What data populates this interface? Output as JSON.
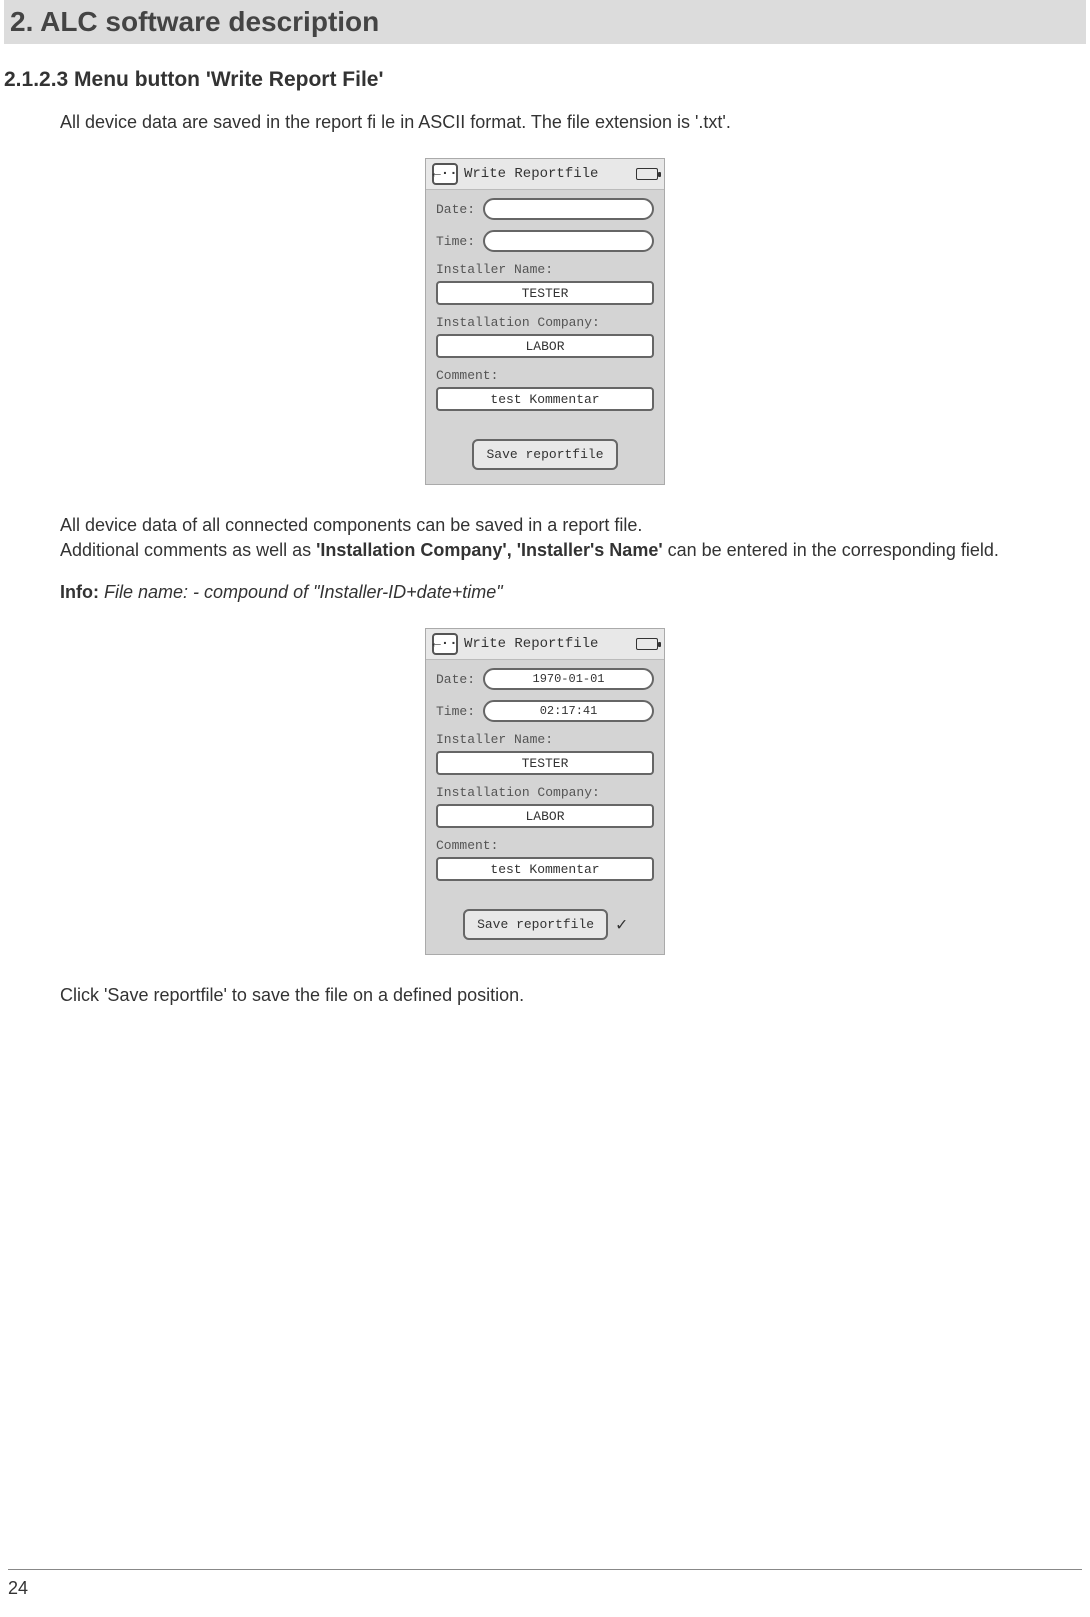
{
  "header": {
    "title": "2. ALC software description"
  },
  "section": {
    "heading": "2.1.2.3 Menu button 'Write Report File'"
  },
  "para1": "All device data are saved in the report fi le in ASCII format. The file extension is '.txt'.",
  "screenshot1": {
    "title": "Write Reportfile",
    "date_label": "Date:",
    "date_value": "",
    "time_label": "Time:",
    "time_value": "",
    "installer_label": "Installer Name:",
    "installer_value": "TESTER",
    "company_label": "Installation Company:",
    "company_value": "LABOR",
    "comment_label": "Comment:",
    "comment_value": "test Kommentar",
    "save_button": "Save reportfile"
  },
  "para2_a": "All device data of all connected components can be saved in a report file.",
  "para2_b_pre": "Additional comments as well as ",
  "para2_b_bold": "'Installation Company', 'Installer's Name'",
  "para2_b_post": " can be entered in the corresponding field.",
  "info_label": "Info:",
  "info_text": " File name: - compound of \"Installer-ID+date+time\"",
  "screenshot2": {
    "title": "Write Reportfile",
    "date_label": "Date:",
    "date_value": "1970-01-01",
    "time_label": "Time:",
    "time_value": "02:17:41",
    "installer_label": "Installer Name:",
    "installer_value": "TESTER",
    "company_label": "Installation Company:",
    "company_value": "LABOR",
    "comment_label": "Comment:",
    "comment_value": "test Kommentar",
    "save_button": "Save reportfile"
  },
  "para3": "Click 'Save reportfile' to save the file on a defined position.",
  "page_number": "24"
}
